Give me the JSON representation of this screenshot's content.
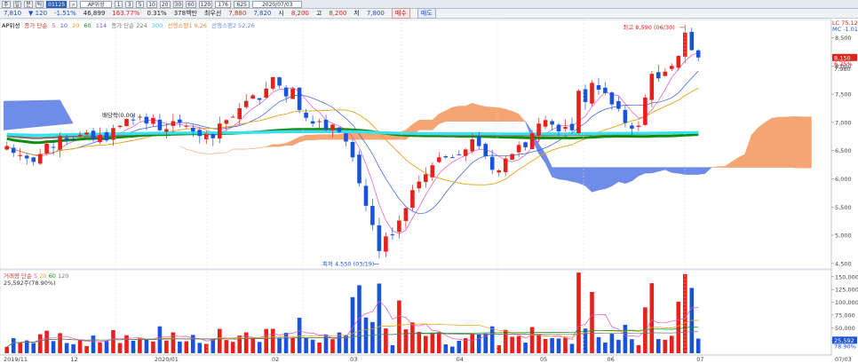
{
  "toolbar": {
    "buttons": [
      "주",
      "일",
      "분",
      "틱"
    ],
    "code": "01125",
    "name": "AP위성",
    "periods": [
      "1",
      "3",
      "5",
      "10",
      "20",
      "30",
      "60",
      "120"
    ],
    "count": "176",
    "total": "625",
    "date": "2020/07/03"
  },
  "quote": {
    "price": "7,810",
    "change": "120",
    "change_pct": "-1.51%",
    "volume": "46,899",
    "vol_pct": "163.77%",
    "turnover": "0.31%",
    "amount": "378백만",
    "prev_close_label": "최우선",
    "bid": "7,880",
    "ask": "7,820",
    "open_label": "시",
    "open": "8,200",
    "high_label": "고",
    "high": "8,200",
    "low_label": "저",
    "low": "7,800",
    "buy_label": "매수",
    "sell_label": "매도"
  },
  "legend": {
    "stock": "AP위성",
    "ma_title": "종가 단순",
    "ma_periods": [
      "5",
      "10",
      "20",
      "60",
      "114"
    ],
    "ma2": "종가 단순 224",
    "ma3": "300",
    "span1": "선행스팬1 9,26",
    "span2": "선행스팬2 52,26"
  },
  "vlegend": {
    "title": "거래량 단순",
    "periods": [
      "5",
      "20",
      "60",
      "120"
    ],
    "value": "25,592주(78.90%)"
  },
  "annotations": {
    "high": "최고 8,590 (06/30)",
    "low": "최저 4,550 (03/19)",
    "dividend": "배당락(0.00)"
  },
  "right_labels": {
    "lc": "LC 75.12",
    "mc": "MC -1.01",
    "current": "8,150",
    "pct": "6.25%",
    "base": "7,980"
  },
  "price_axis": [
    "8,500",
    "8,000",
    "7,500",
    "7,000",
    "6,500",
    "6,000",
    "5,500",
    "5,000",
    "4,500"
  ],
  "volume_axis": [
    "150,000",
    "125,000",
    "100,000",
    "75,000",
    "50,000",
    "25,000"
  ],
  "volume_labels": {
    "v1": "25,592",
    "v2": "78.90%"
  },
  "date_axis": [
    "2019/11",
    "12",
    "2020/01",
    "02",
    "03",
    "04",
    "05",
    "06",
    "07",
    "07/03"
  ],
  "colors": {
    "up": "#e8201a",
    "down": "#1a52e0",
    "cloud_bull": "#f4a573",
    "cloud_bear": "#6f8de8",
    "ma_green": "#0b8f0b",
    "ma_cyan": "#38e1f0",
    "ma_gray": "#777777",
    "ma_orange": "#e3a41a",
    "ma_pink": "#e04fc0"
  },
  "chart_data": {
    "type": "candlestick",
    "price_range": [
      4450,
      8650
    ],
    "volume_range": [
      0,
      160000
    ],
    "series": {
      "close": [
        6580,
        6460,
        6420,
        6360,
        6300,
        6440,
        6620,
        6560,
        6760,
        6680,
        6700,
        6780,
        6820,
        6700,
        6780,
        6680,
        6900,
        6940,
        7060,
        7040,
        7100,
        6980,
        7080,
        6860,
        6880,
        7020,
        6990,
        6940,
        6840,
        6760,
        6800,
        6720,
        6980,
        7040,
        7100,
        7250,
        7380,
        7480,
        7400,
        7600,
        7800,
        7650,
        7460,
        7600,
        7220,
        7080,
        6980,
        7020,
        6880,
        6960,
        6830,
        6660,
        6380,
        5920,
        5520,
        5180,
        4720,
        4980,
        5000,
        5260,
        5480,
        5800,
        5950,
        6080,
        6240,
        6380,
        6380,
        6380,
        6420,
        6520,
        6700,
        6580,
        6400,
        6160,
        6150,
        6360,
        6440,
        6600,
        6560,
        6810,
        6980,
        7040,
        6960,
        6840,
        6920,
        6860,
        7560,
        7360,
        7700,
        7580,
        7520,
        7320,
        7240,
        6990,
        6890,
        6940,
        7440,
        7860,
        7780,
        7900,
        8000,
        8180,
        8590,
        8280,
        8150
      ]
    }
  }
}
